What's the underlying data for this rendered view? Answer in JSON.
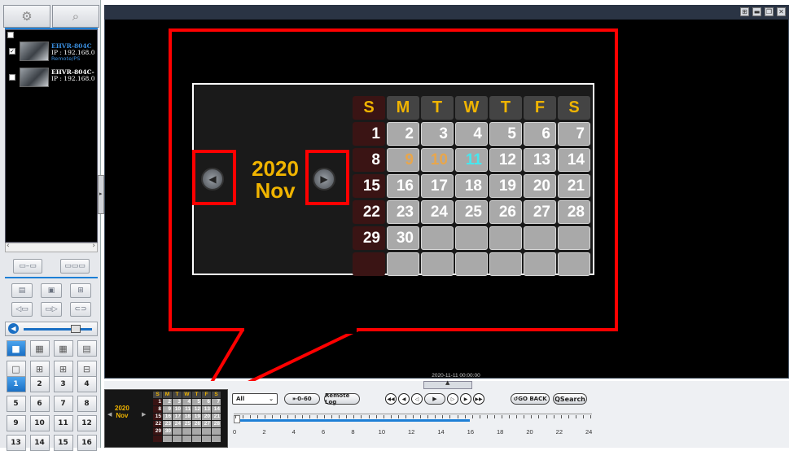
{
  "left_panel": {
    "tabs": [
      {
        "icon": "settings-icon"
      },
      {
        "icon": "search-icon"
      }
    ],
    "devices": [
      {
        "name": "EHVR-804C",
        "ip": "IP : 192.168.0",
        "status": "Remote/PS",
        "checked": true,
        "name_color": "#3a8fe0"
      },
      {
        "name": "EHVR-804C-",
        "ip": "IP : 192.168.0",
        "status": "",
        "checked": false,
        "name_color": "#ffffff"
      }
    ],
    "layout_numbers": [
      "1",
      "2",
      "3",
      "4",
      "5",
      "6",
      "7",
      "8",
      "9",
      "10",
      "11",
      "12",
      "13",
      "14",
      "15",
      "16"
    ]
  },
  "zoom_calendar": {
    "year": "2020",
    "month": "Nov",
    "headers": [
      "S",
      "M",
      "T",
      "W",
      "T",
      "F",
      "S"
    ],
    "weeks": [
      [
        "1",
        "2",
        "3",
        "4",
        "5",
        "6",
        "7"
      ],
      [
        "8",
        "9",
        "10",
        "11",
        "12",
        "13",
        "14"
      ],
      [
        "15",
        "16",
        "17",
        "18",
        "19",
        "20",
        "21"
      ],
      [
        "22",
        "23",
        "24",
        "25",
        "26",
        "27",
        "28"
      ],
      [
        "29",
        "30",
        "",
        "",
        "",
        "",
        ""
      ],
      [
        "",
        "",
        "",
        "",
        "",
        "",
        ""
      ]
    ]
  },
  "timeline": {
    "current_time": "2020-11-11 00:00:00",
    "channel_filter": "All",
    "jump_label": "⇤0-60",
    "remote_log_label": "Remote Log",
    "go_back_label": "GO BACK",
    "qsearch_label": "QSearch",
    "hours": [
      "0",
      "2",
      "4",
      "6",
      "8",
      "10",
      "12",
      "14",
      "16",
      "18",
      "20",
      "22",
      "24"
    ]
  },
  "colors": {
    "accent": "#f0b400",
    "highlight": "#ff0000",
    "today": "#44e8f0"
  }
}
